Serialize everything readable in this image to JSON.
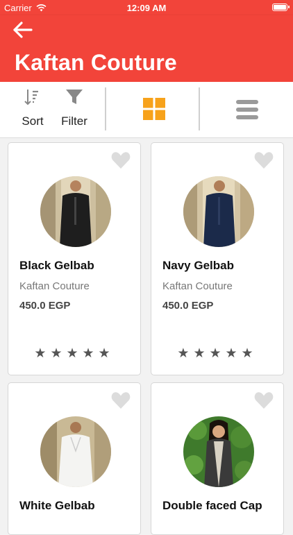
{
  "status_bar": {
    "carrier": "Carrier",
    "time": "12:09 AM"
  },
  "header": {
    "title": "Kaftan Couture"
  },
  "toolbar": {
    "sort_label": "Sort",
    "filter_label": "Filter"
  },
  "colors": {
    "header": "#f2443a",
    "grid_icon": "#f7a21b"
  },
  "products": [
    {
      "name": "Black Gelbab",
      "brand": "Kaftan Couture",
      "price": "450.0 EGP",
      "stars": "★★★★★",
      "rating": 5
    },
    {
      "name": "Navy Gelbab",
      "brand": "Kaftan Couture",
      "price": "450.0 EGP",
      "stars": "★★★★★",
      "rating": 5
    },
    {
      "name": "White Gelbab",
      "brand": "",
      "price": "",
      "stars": "",
      "rating": 0
    },
    {
      "name": "Double faced Cap",
      "brand": "",
      "price": "",
      "stars": "",
      "rating": 0
    }
  ]
}
